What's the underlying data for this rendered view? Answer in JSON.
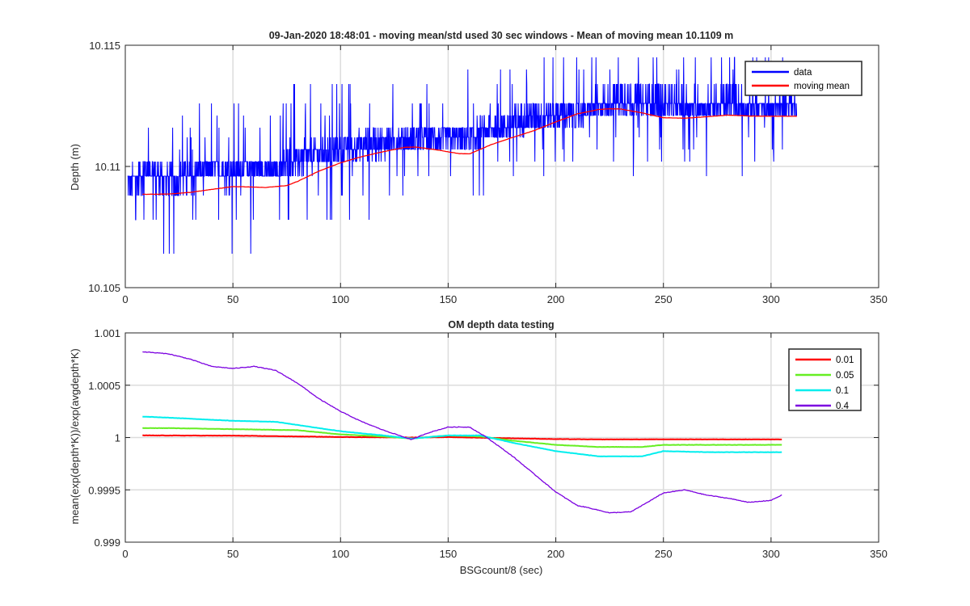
{
  "chart_data": [
    {
      "type": "line",
      "title": "09-Jan-2020 18:48:01 - moving mean/std used 30 sec windows - Mean of moving mean 10.1109 m",
      "xlabel": "",
      "ylabel": "Depth (m)",
      "xlim": [
        0,
        350
      ],
      "ylim": [
        10.105,
        10.115
      ],
      "xticks": [
        "0",
        "50",
        "100",
        "150",
        "200",
        "250",
        "300",
        "350"
      ],
      "yticks": [
        "10.105",
        "10.11",
        "10.115"
      ],
      "grid": true,
      "legend_position": "top-right",
      "series": [
        {
          "name": "data",
          "color": "#0000ff",
          "description": "noisy measured depth, quantized around 10.1088-10.1145",
          "x": [
            1,
            10,
            20,
            30,
            40,
            50,
            60,
            70,
            80,
            90,
            100,
            110,
            120,
            130,
            140,
            150,
            160,
            170,
            180,
            190,
            200,
            210,
            220,
            230,
            240,
            250,
            260,
            270,
            280,
            290,
            300,
            312
          ],
          "y": [
            10.1092,
            10.1098,
            10.1094,
            10.1096,
            10.1099,
            10.1097,
            10.1099,
            10.1098,
            10.1103,
            10.1105,
            10.1107,
            10.1109,
            10.111,
            10.1111,
            10.1112,
            10.1112,
            10.1112,
            10.1115,
            10.1118,
            10.1121,
            10.1122,
            10.1122,
            10.1125,
            10.1128,
            10.1127,
            10.1126,
            10.1125,
            10.1125,
            10.1126,
            10.1125,
            10.1124,
            10.1127
          ]
        },
        {
          "name": "moving mean",
          "color": "#ff0000",
          "x": [
            8,
            20,
            30,
            40,
            50,
            60,
            65,
            75,
            80,
            90,
            100,
            110,
            120,
            130,
            135,
            145,
            155,
            160,
            170,
            180,
            190,
            200,
            210,
            220,
            225,
            230,
            240,
            250,
            260,
            270,
            280,
            290,
            300,
            312
          ],
          "y": [
            10.10885,
            10.10886,
            10.10893,
            10.10905,
            10.10917,
            10.10915,
            10.10913,
            10.10921,
            10.10938,
            10.10981,
            10.11015,
            10.11041,
            10.11061,
            10.11079,
            10.1108,
            10.11068,
            10.11053,
            10.11052,
            10.1109,
            10.1112,
            10.11148,
            10.11184,
            10.11217,
            10.11235,
            10.11238,
            10.11237,
            10.11221,
            10.11201,
            10.11199,
            10.11205,
            10.11212,
            10.11208,
            10.11207,
            10.11207
          ]
        }
      ]
    },
    {
      "type": "line",
      "title": "OM depth data testing",
      "xlabel": "BSGcount/8 (sec)",
      "ylabel": "mean(exp(depth*K))/exp(avgdepth*K)",
      "xlim": [
        0,
        350
      ],
      "ylim": [
        0.999,
        1.001
      ],
      "xticks": [
        "0",
        "50",
        "100",
        "150",
        "200",
        "250",
        "300",
        "350"
      ],
      "yticks": [
        "0.999",
        "0.9995",
        "1",
        "1.0005",
        "1.001"
      ],
      "grid": true,
      "legend_position": "top-right",
      "series": [
        {
          "name": "0.01",
          "color": "#ff0000",
          "x": [
            8,
            50,
            100,
            133,
            150,
            200,
            220,
            250,
            305
          ],
          "y": [
            1.00002,
            1.000018,
            1.000005,
            1.0,
            1.000004,
            0.999985,
            0.999982,
            0.999983,
            0.999982
          ]
        },
        {
          "name": "0.05",
          "color": "#66ee22",
          "x": [
            8,
            20,
            50,
            80,
            100,
            120,
            133,
            150,
            165,
            180,
            200,
            220,
            240,
            250,
            270,
            305
          ],
          "y": [
            1.00009,
            1.00009,
            1.00008,
            1.00007,
            1.00003,
            1.00001,
            0.99999,
            1.00002,
            1.00001,
            0.99997,
            0.99993,
            0.99991,
            0.99991,
            0.99993,
            0.99993,
            0.99993
          ]
        },
        {
          "name": "0.1",
          "color": "#00eeee",
          "x": [
            8,
            20,
            50,
            70,
            80,
            100,
            120,
            133,
            150,
            165,
            180,
            200,
            220,
            240,
            250,
            270,
            305
          ],
          "y": [
            1.0002,
            1.00019,
            1.00016,
            1.00015,
            1.00012,
            1.00006,
            1.00002,
            0.99999,
            1.00002,
            1.00002,
            0.99995,
            0.99987,
            0.99982,
            0.99982,
            0.99987,
            0.99986,
            0.99986
          ]
        },
        {
          "name": "0.4",
          "color": "#7b00e0",
          "x": [
            8,
            20,
            30,
            40,
            50,
            60,
            70,
            80,
            90,
            100,
            110,
            120,
            133,
            140,
            150,
            160,
            168,
            180,
            190,
            200,
            210,
            215,
            225,
            235,
            240,
            250,
            260,
            270,
            280,
            290,
            300,
            305
          ],
          "y": [
            1.00082,
            1.0008,
            1.00075,
            1.00068,
            1.00066,
            1.00068,
            1.00064,
            1.00052,
            1.00037,
            1.00025,
            1.00015,
            1.00007,
            0.99998,
            1.00004,
            1.0001,
            1.0001,
            1.0,
            0.99982,
            0.99965,
            0.99948,
            0.99935,
            0.99933,
            0.99928,
            0.99929,
            0.99935,
            0.99947,
            0.9995,
            0.99945,
            0.99942,
            0.99938,
            0.9994,
            0.99945
          ]
        }
      ]
    }
  ]
}
